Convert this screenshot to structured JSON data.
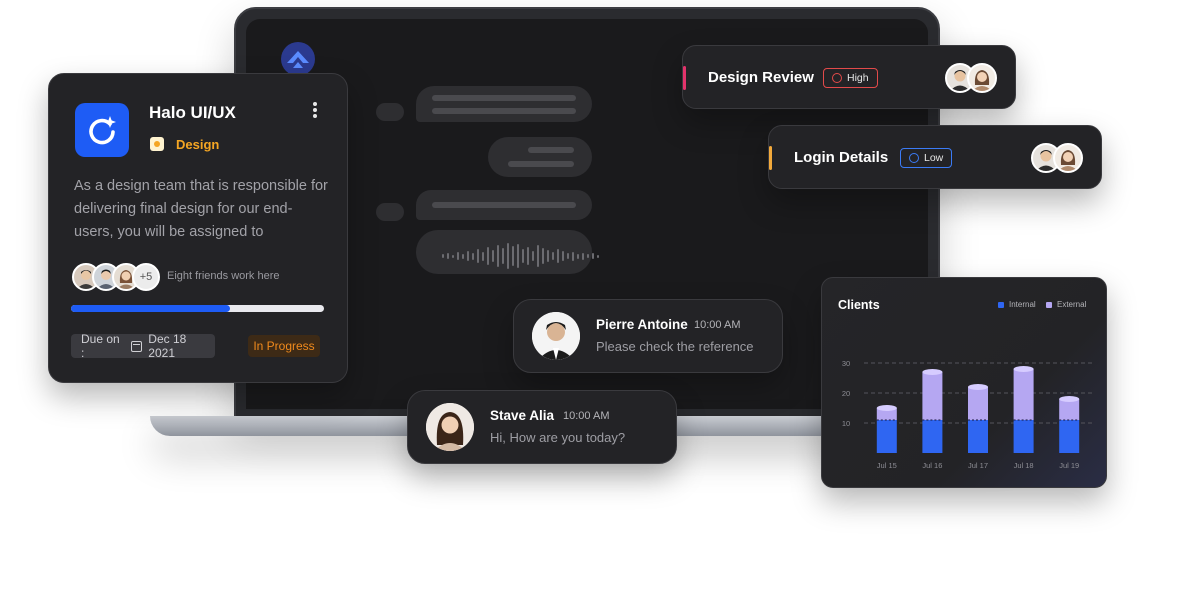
{
  "project_card": {
    "title": "Halo UI/UX",
    "tag": "Design",
    "description": "As a design team that is responsible for delivering final design for our end-users, you will be assigned to",
    "extra_friends": "+5",
    "friends_text": "Eight friends work here",
    "progress": 0.63,
    "due_label": "Due on :",
    "due_date": "Dec 18 2021",
    "status": "In Progress",
    "colors": {
      "brand": "#1e5cf5",
      "tag": "#f5a623",
      "status": "#f08a1c"
    }
  },
  "tasks": [
    {
      "title": "Design Review",
      "priority": "High",
      "accent": "#e2336b",
      "priority_color": "#e24a4a",
      "icon": "alert-icon"
    },
    {
      "title": "Login Details",
      "priority": "Low",
      "accent": "#f2a93b",
      "priority_color": "#3b7bf6",
      "icon": "clock-icon"
    }
  ],
  "chats": [
    {
      "name": "Pierre Antoine",
      "time": "10:00 AM",
      "message": "Please check the reference"
    },
    {
      "name": "Stave Alia",
      "time": "10:00 AM",
      "message": "Hi, How are you today?"
    }
  ],
  "chart_data": {
    "type": "bar",
    "title": "Clients",
    "stacked": true,
    "categories": [
      "Jul 15",
      "Jul 16",
      "Jul 17",
      "Jul 18",
      "Jul 19"
    ],
    "series": [
      {
        "name": "Internal",
        "color": "#2f66f2",
        "values": [
          11,
          11,
          11,
          11,
          11
        ]
      },
      {
        "name": "External",
        "color": "#b5a7f2",
        "values": [
          4,
          16,
          11,
          17,
          7
        ]
      }
    ],
    "y_ticks": [
      10,
      20,
      30
    ],
    "ylim": [
      0,
      40
    ],
    "grid": "dashed horizontal",
    "legend": "top-right"
  }
}
